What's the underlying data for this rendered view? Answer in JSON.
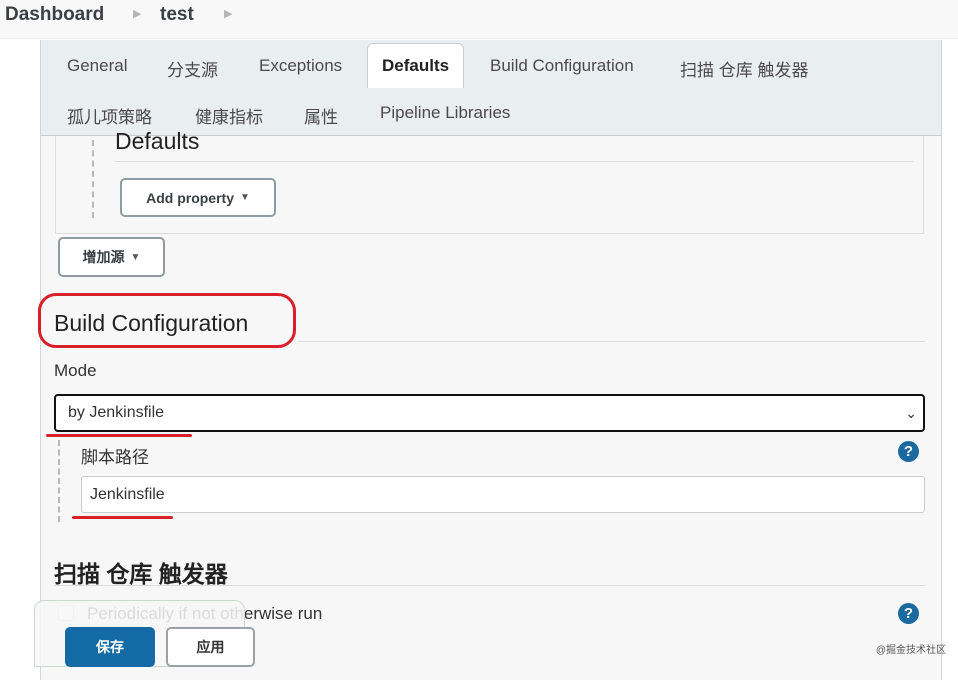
{
  "breadcrumb": {
    "items": [
      {
        "label": "Dashboard"
      },
      {
        "label": "test"
      }
    ],
    "separator_icon": "chevron-right-icon"
  },
  "tabs": [
    {
      "label": "General",
      "active": false
    },
    {
      "label": "分支源",
      "active": false
    },
    {
      "label": "Exceptions",
      "active": false
    },
    {
      "label": "Defaults",
      "active": true
    },
    {
      "label": "Build Configuration",
      "active": false
    },
    {
      "label": "扫描 仓库 触发器",
      "active": false
    },
    {
      "label": "孤儿项策略",
      "active": false
    },
    {
      "label": "健康指标",
      "active": false
    },
    {
      "label": "属性",
      "active": false
    },
    {
      "label": "Pipeline Libraries",
      "active": false
    }
  ],
  "defaults_section": {
    "title": "Defaults",
    "add_property_label": "Add property",
    "add_source_label": "增加源"
  },
  "build_configuration": {
    "title": "Build Configuration",
    "mode_label": "Mode",
    "mode_value": "by Jenkinsfile",
    "script_path_label": "脚本路径",
    "script_path_value": "Jenkinsfile"
  },
  "scan_triggers": {
    "title": "扫描 仓库 触发器",
    "periodic_label": "Periodically if not otherwise run",
    "periodic_checked": false
  },
  "actions": {
    "save_label": "保存",
    "apply_label": "应用"
  },
  "watermark": "@掘金技术社区",
  "colors": {
    "primary": "#136aa5",
    "annotation_red": "#d9202a",
    "help_icon": "#1a6aa1"
  }
}
